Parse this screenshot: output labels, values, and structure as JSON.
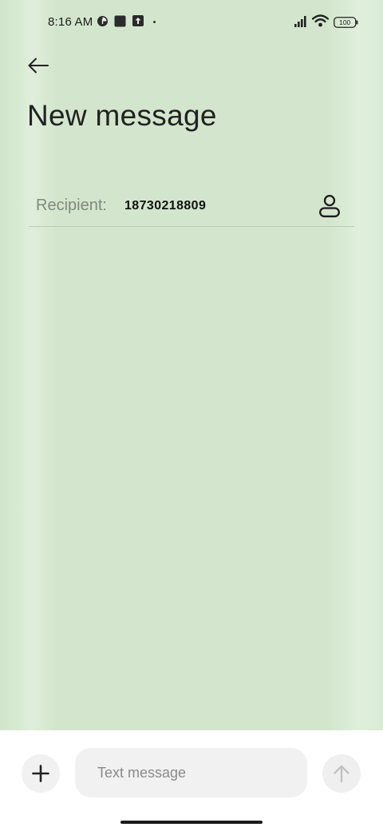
{
  "status_bar": {
    "time": "8:16 AM",
    "battery": "100",
    "icons": [
      "data-saver-icon",
      "app-notification-icon",
      "upload-icon",
      "notification-dot",
      "signal-icon",
      "wifi-icon",
      "battery-icon"
    ]
  },
  "header": {
    "back_icon": "arrow-left-icon",
    "title": "New message"
  },
  "recipient": {
    "label": "Recipient:",
    "value": "18730218809",
    "contact_icon": "person-icon"
  },
  "compose": {
    "add_icon": "plus-icon",
    "placeholder": "Text message",
    "value": "",
    "send_icon": "arrow-up-icon"
  },
  "colors": {
    "background": "#d3e6cd",
    "compose_bar": "#ffffff",
    "input_bg": "#f1f1f1",
    "title": "#222222",
    "label": "#7f8a7e"
  }
}
